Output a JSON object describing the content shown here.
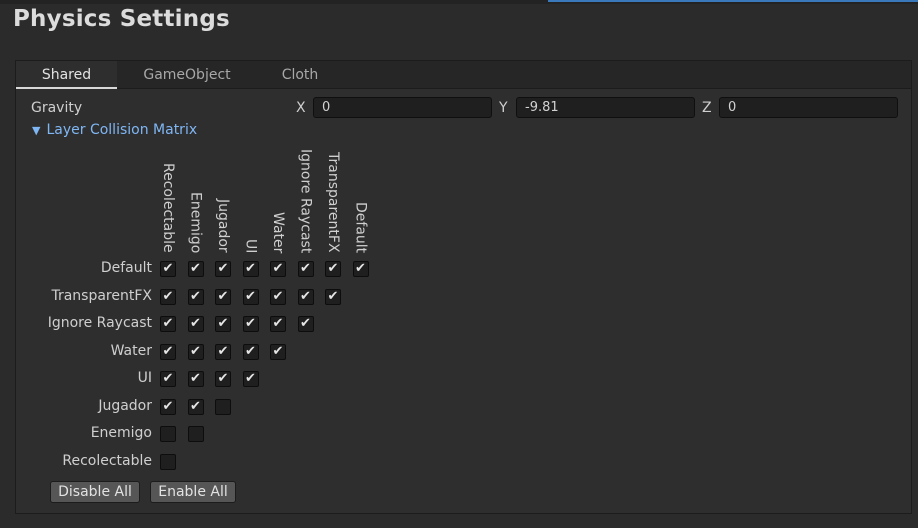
{
  "window": {
    "title": "Physics Settings"
  },
  "tabs": [
    {
      "label": "Shared",
      "active": true
    },
    {
      "label": "GameObject",
      "active": false
    },
    {
      "label": "Cloth",
      "active": false
    }
  ],
  "gravity": {
    "label": "Gravity",
    "x_label": "X",
    "x": "0",
    "y_label": "Y",
    "y": "-9.81",
    "z_label": "Z",
    "z": "0"
  },
  "matrix": {
    "foldout_label": "Layer Collision Matrix",
    "expanded": true,
    "columns": [
      "Recolectable",
      "Enemigo",
      "Jugador",
      "UI",
      "Water",
      "Ignore Raycast",
      "TransparentFX",
      "Default"
    ],
    "rows": [
      {
        "label": "Default",
        "checks": [
          true,
          true,
          true,
          true,
          true,
          true,
          true,
          true
        ]
      },
      {
        "label": "TransparentFX",
        "checks": [
          true,
          true,
          true,
          true,
          true,
          true,
          true
        ]
      },
      {
        "label": "Ignore Raycast",
        "checks": [
          true,
          true,
          true,
          true,
          true,
          true
        ]
      },
      {
        "label": "Water",
        "checks": [
          true,
          true,
          true,
          true,
          true
        ]
      },
      {
        "label": "UI",
        "checks": [
          true,
          true,
          true,
          true
        ]
      },
      {
        "label": "Jugador",
        "checks": [
          true,
          true,
          false
        ]
      },
      {
        "label": "Enemigo",
        "checks": [
          false,
          false
        ]
      },
      {
        "label": "Recolectable",
        "checks": [
          false
        ]
      }
    ]
  },
  "buttons": {
    "disable_all": "Disable All",
    "enable_all": "Enable All"
  },
  "colors": {
    "accent": "#3a79bb",
    "foldout": "#7fb6f4",
    "background": "#2b2b2b"
  }
}
